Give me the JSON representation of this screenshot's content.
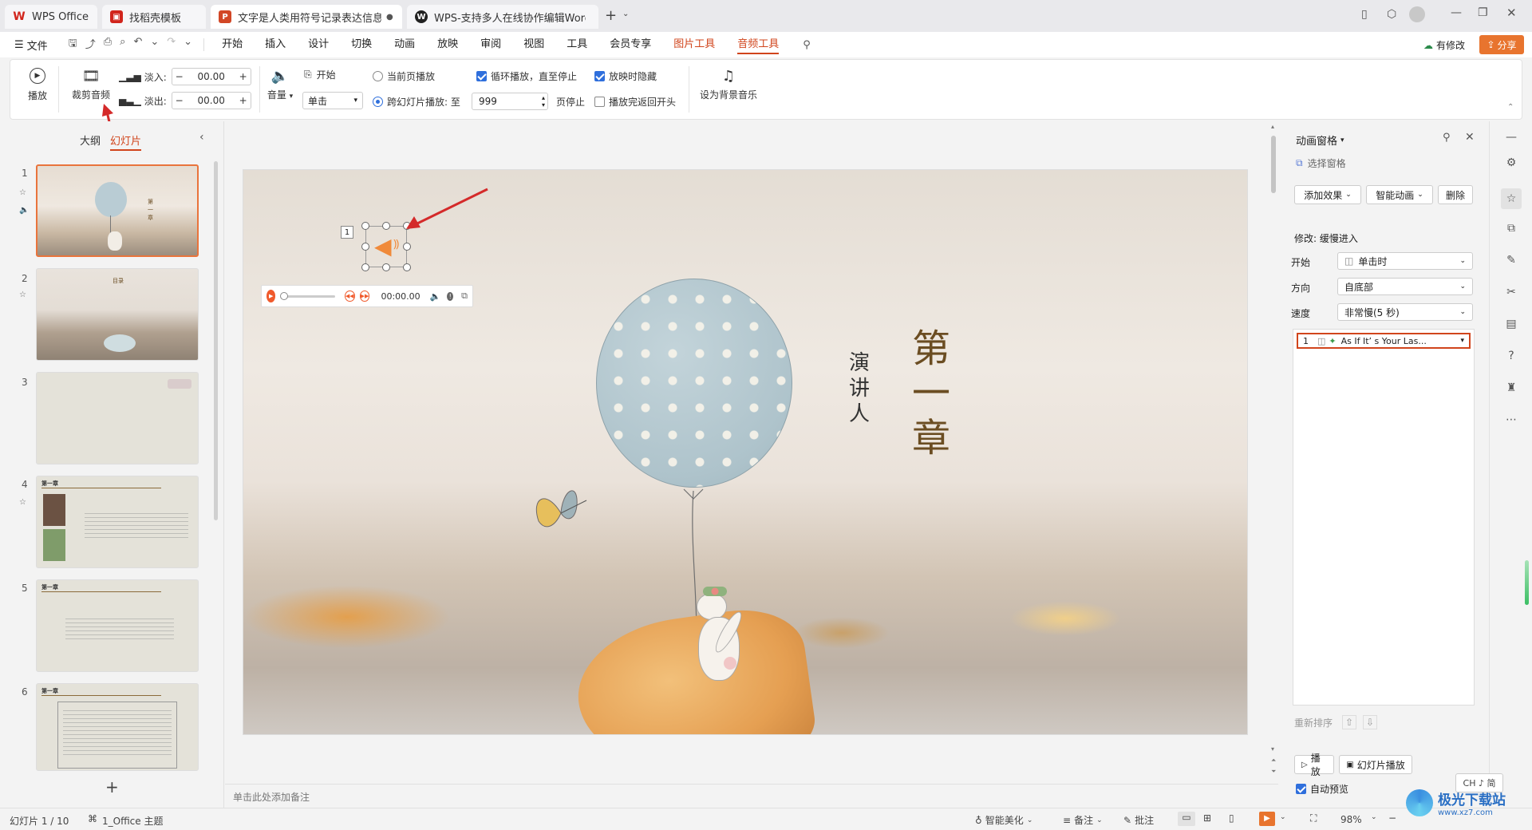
{
  "tabs": [
    {
      "label": "WPS Office",
      "icon": "wps-logo-icon",
      "color": "#d1251c"
    },
    {
      "label": "找稻壳模板",
      "icon": "docer-icon",
      "color": "#d1251c"
    },
    {
      "label": "文字是人类用符号记录表达信息以",
      "icon": "ppt-icon",
      "color": "#d24726"
    },
    {
      "label": "WPS-支持多人在线协作编辑Word、",
      "icon": "wps-cloud-icon",
      "color": "#222222"
    }
  ],
  "menu": {
    "file": "文件",
    "items": [
      "开始",
      "插入",
      "设计",
      "切换",
      "动画",
      "放映",
      "审阅",
      "视图",
      "工具",
      "会员专享",
      "图片工具",
      "音频工具"
    ],
    "has_changes": "有修改",
    "share": "分享"
  },
  "ribbon": {
    "play": "播放",
    "trim_audio": "裁剪音频",
    "fade_in_label": "淡入:",
    "fade_in_value": "00.00",
    "fade_out_label": "淡出:",
    "fade_out_value": "00.00",
    "volume": "音量",
    "start_label": "开始",
    "start_select": "单击",
    "current_page": "当前页播放",
    "cross_slide": "跨幻灯片播放: 至",
    "cross_slide_value": "999",
    "page_stop": "页停止",
    "loop": "循环播放，直至停止",
    "hide_while_playing": "放映时隐藏",
    "rewind": "播放完返回开头",
    "set_bg_music": "设为背景音乐"
  },
  "left_panel": {
    "outline_tab": "大纲",
    "slides_tab": "幻灯片",
    "slide_numbers": [
      "1",
      "2",
      "3",
      "4",
      "5",
      "6"
    ],
    "thumb4_title": "第一章",
    "thumb5_title": "第一章",
    "thumb6_title": "第一章",
    "thumb2_title": "目录"
  },
  "slide": {
    "anim_number": "1",
    "time": "00:00.00",
    "title_chars": [
      "第",
      "一",
      "章"
    ],
    "presenter_chars": [
      "演",
      "讲",
      "人"
    ]
  },
  "notes_placeholder": "单击此处添加备注",
  "anim_panel": {
    "title": "动画窗格",
    "select_pane": "选择窗格",
    "add_effect": "添加效果",
    "smart_anim": "智能动画",
    "delete": "删除",
    "modify_label": "修改: 缓慢进入",
    "start_label": "开始",
    "start_value": "单击时",
    "direction_label": "方向",
    "direction_value": "自底部",
    "speed_label": "速度",
    "speed_value": "非常慢(5 秒)",
    "item_number": "1",
    "item_label": "As If It’ s Your Las...",
    "reorder": "重新排序",
    "play": "播放",
    "slideshow": "幻灯片播放",
    "auto_preview": "自动预览"
  },
  "status": {
    "slide_count": "幻灯片 1 / 10",
    "theme": "1_Office 主题",
    "smart_beautify": "智能美化",
    "notes": "备注",
    "comments": "批注",
    "zoom": "98%",
    "ime": "CH ♪ 简"
  },
  "watermark": {
    "text": "极光下载站",
    "url": "www.xz7.com"
  },
  "colors": {
    "accent": "#d1451c",
    "selection": "#e9743c",
    "check": "#2f6fdc",
    "title_text": "#7a5a2a"
  }
}
